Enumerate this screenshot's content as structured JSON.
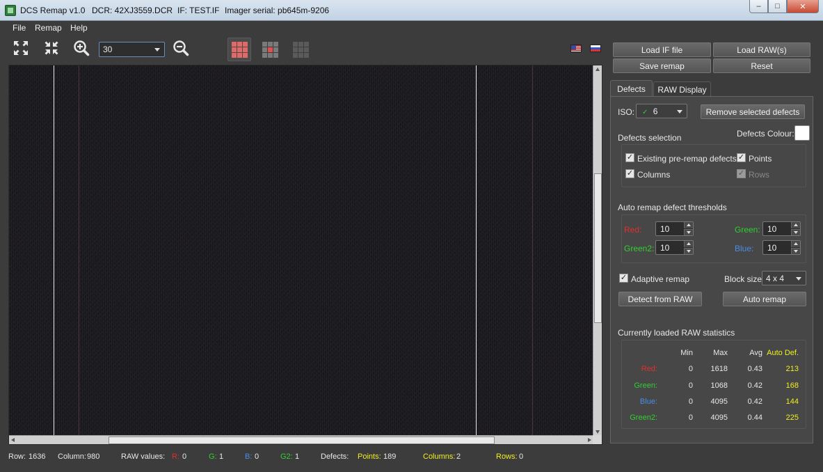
{
  "window": {
    "app_name": "DCS Remap v1.0",
    "dcr": "DCR: 42XJ3559.DCR",
    "if_file": "IF: TEST.IF",
    "imager": "Imager serial: pb645m-9206",
    "minimize": "–",
    "maximize": "□",
    "close": "✕"
  },
  "menu": {
    "file": "File",
    "remap": "Remap",
    "help": "Help"
  },
  "toolbar": {
    "zoom_value": "30",
    "flags": [
      "us-flag-icon",
      "ru-flag-icon"
    ]
  },
  "actions": {
    "load_if": "Load IF file",
    "load_raw": "Load RAW(s)",
    "save_remap": "Save remap",
    "reset": "Reset"
  },
  "tabs": {
    "defects": "Defects",
    "raw_display": "RAW Display"
  },
  "defects": {
    "iso_label": "ISO:",
    "iso_value": "6",
    "iso_check": "✓",
    "remove_selected": "Remove selected defects",
    "selection_title": "Defects selection",
    "colour_label": "Defects Colour:",
    "colour_value": "#ffffff",
    "existing": "Existing pre-remap defects",
    "points": "Points",
    "columns": "Columns",
    "rows": "Rows",
    "thresholds_title": "Auto remap defect thresholds",
    "red_label": "Red:",
    "red_value": "10",
    "green_label": "Green:",
    "green_value": "10",
    "green2_label": "Green2:",
    "green2_value": "10",
    "blue_label": "Blue:",
    "blue_value": "10",
    "adaptive": "Adaptive remap",
    "block_label": "Block size:",
    "block_value": "4 x 4",
    "detect": "Detect from RAW",
    "auto_remap": "Auto remap",
    "check_mark": "✓"
  },
  "stats": {
    "title": "Currently loaded RAW statistics",
    "headers": [
      "Min",
      "Max",
      "Avg",
      "Auto Def."
    ],
    "rows": [
      {
        "name": "Red:",
        "min": "0",
        "max": "1618",
        "avg": "0.43",
        "def": "213"
      },
      {
        "name": "Green:",
        "min": "0",
        "max": "1068",
        "avg": "0.42",
        "def": "168"
      },
      {
        "name": "Blue:",
        "min": "0",
        "max": "4095",
        "avg": "0.42",
        "def": "144"
      },
      {
        "name": "Green2:",
        "min": "0",
        "max": "4095",
        "avg": "0.44",
        "def": "225"
      }
    ]
  },
  "status": {
    "row_label": "Row:",
    "row_value": "1636",
    "col_label": "Column:",
    "col_value": "980",
    "raw_label": "RAW values:",
    "r_label": "R:",
    "r_value": "0",
    "g_label": "G:",
    "g_value": "1",
    "b_label": "B:",
    "b_value": "0",
    "g2_label": "G2:",
    "g2_value": "1",
    "defects_label": "Defects:",
    "points_label": "Points:",
    "points_value": "189",
    "columns_label": "Columns:",
    "columns_value": "2",
    "rows_label": "Rows:",
    "rows_value": "0"
  },
  "colors": {
    "red": "#e03030",
    "green": "#30d030",
    "blue": "#4a8ee8",
    "yellow": "#f0f020"
  }
}
